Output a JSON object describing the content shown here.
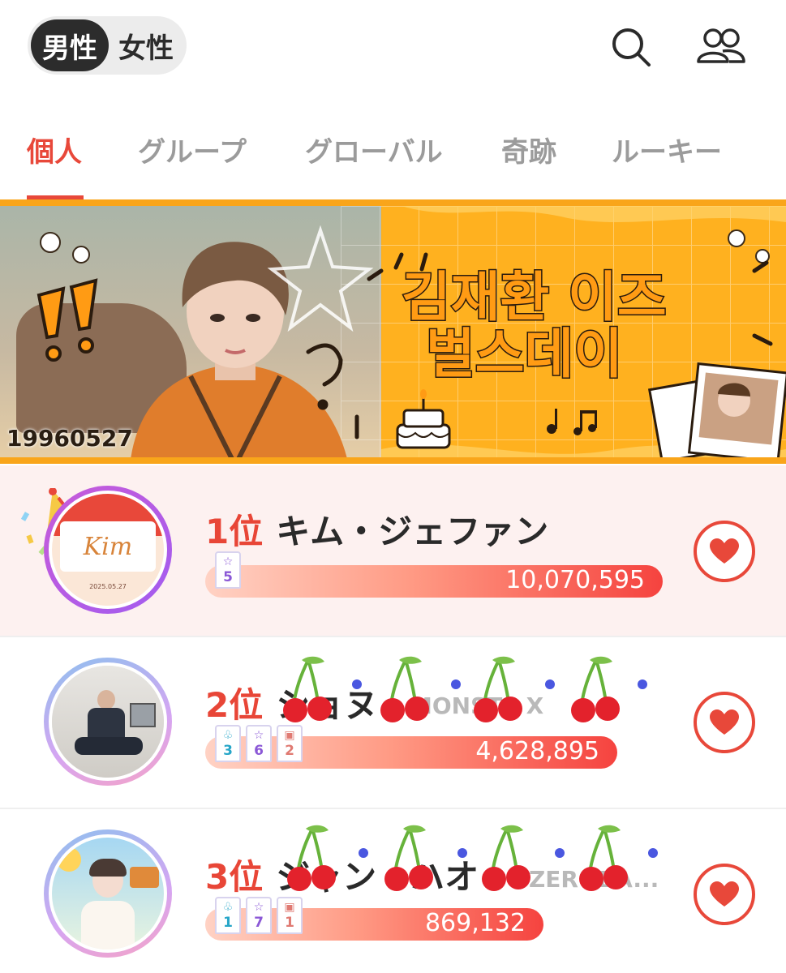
{
  "header": {
    "gender_male": "男性",
    "gender_female": "女性",
    "search_icon": "search-icon",
    "friends_icon": "people-icon"
  },
  "tabs": [
    {
      "label": "個人",
      "active": true
    },
    {
      "label": "グループ",
      "active": false
    },
    {
      "label": "グローバル",
      "active": false
    },
    {
      "label": "奇跡",
      "active": false
    },
    {
      "label": "ルーキー",
      "active": false
    }
  ],
  "banner": {
    "date_text": "19960527",
    "korean_title_line1": "김재환 이즈",
    "korean_title_line2": "벌스데이"
  },
  "rankings": [
    {
      "rank": "1位",
      "name": "キム・ジェファン",
      "group": "",
      "votes": "10,070,595",
      "bar_fraction": 1.0,
      "badges": [
        {
          "icon": "star-icon",
          "count": "5",
          "color": "purple"
        }
      ],
      "avatar_text": "Kim",
      "avatar_subtext": "2025.05.27"
    },
    {
      "rank": "2位",
      "name": "ショヌ",
      "group": "MONSTA X",
      "votes": "4,628,895",
      "bar_fraction": 0.46,
      "badges": [
        {
          "icon": "wing-icon",
          "count": "3",
          "color": "blue"
        },
        {
          "icon": "star-icon",
          "count": "6",
          "color": "purple"
        },
        {
          "icon": "cake-icon",
          "count": "2",
          "color": "red"
        }
      ]
    },
    {
      "rank": "3位",
      "name": "ジャン・ハオ",
      "group": "ZEROBA...",
      "votes": "869,132",
      "bar_fraction": 0.09,
      "badges": [
        {
          "icon": "wing-icon",
          "count": "1",
          "color": "blue"
        },
        {
          "icon": "star-icon",
          "count": "7",
          "color": "purple"
        },
        {
          "icon": "cake-icon",
          "count": "1",
          "color": "red"
        }
      ]
    }
  ],
  "colors": {
    "accent": "#e8483a",
    "banner": "#ffb11f",
    "highlight_row": "#fdf1f0"
  }
}
